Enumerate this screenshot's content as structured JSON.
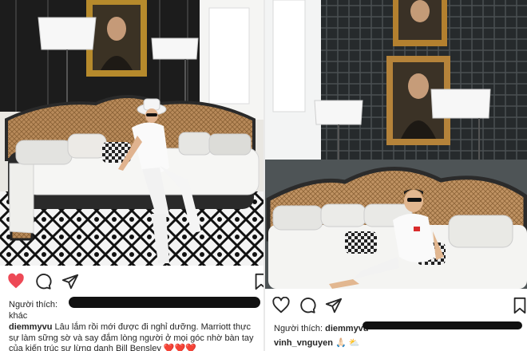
{
  "left_post": {
    "likes_label": "Người thích:",
    "likes_suffix": "khác",
    "username": "diemmyvu",
    "caption": "Lâu lắm rồi mới được đi nghỉ dưỡng. Marriott thực sự làm sững sờ và say đắm lòng người  ở mọi góc nhờ bàn tay của  kiến trúc sư lừng danh Bill Bensley",
    "caption_emoji": "❤️❤️❤️",
    "colors": {
      "like_active": "#ed4956"
    }
  },
  "right_post": {
    "likes_label": "Người thích:",
    "liker": "diemmyvu",
    "comment_username": "vinh_vnguyen",
    "comment_emoji": "🙏🏻 ⛅"
  }
}
